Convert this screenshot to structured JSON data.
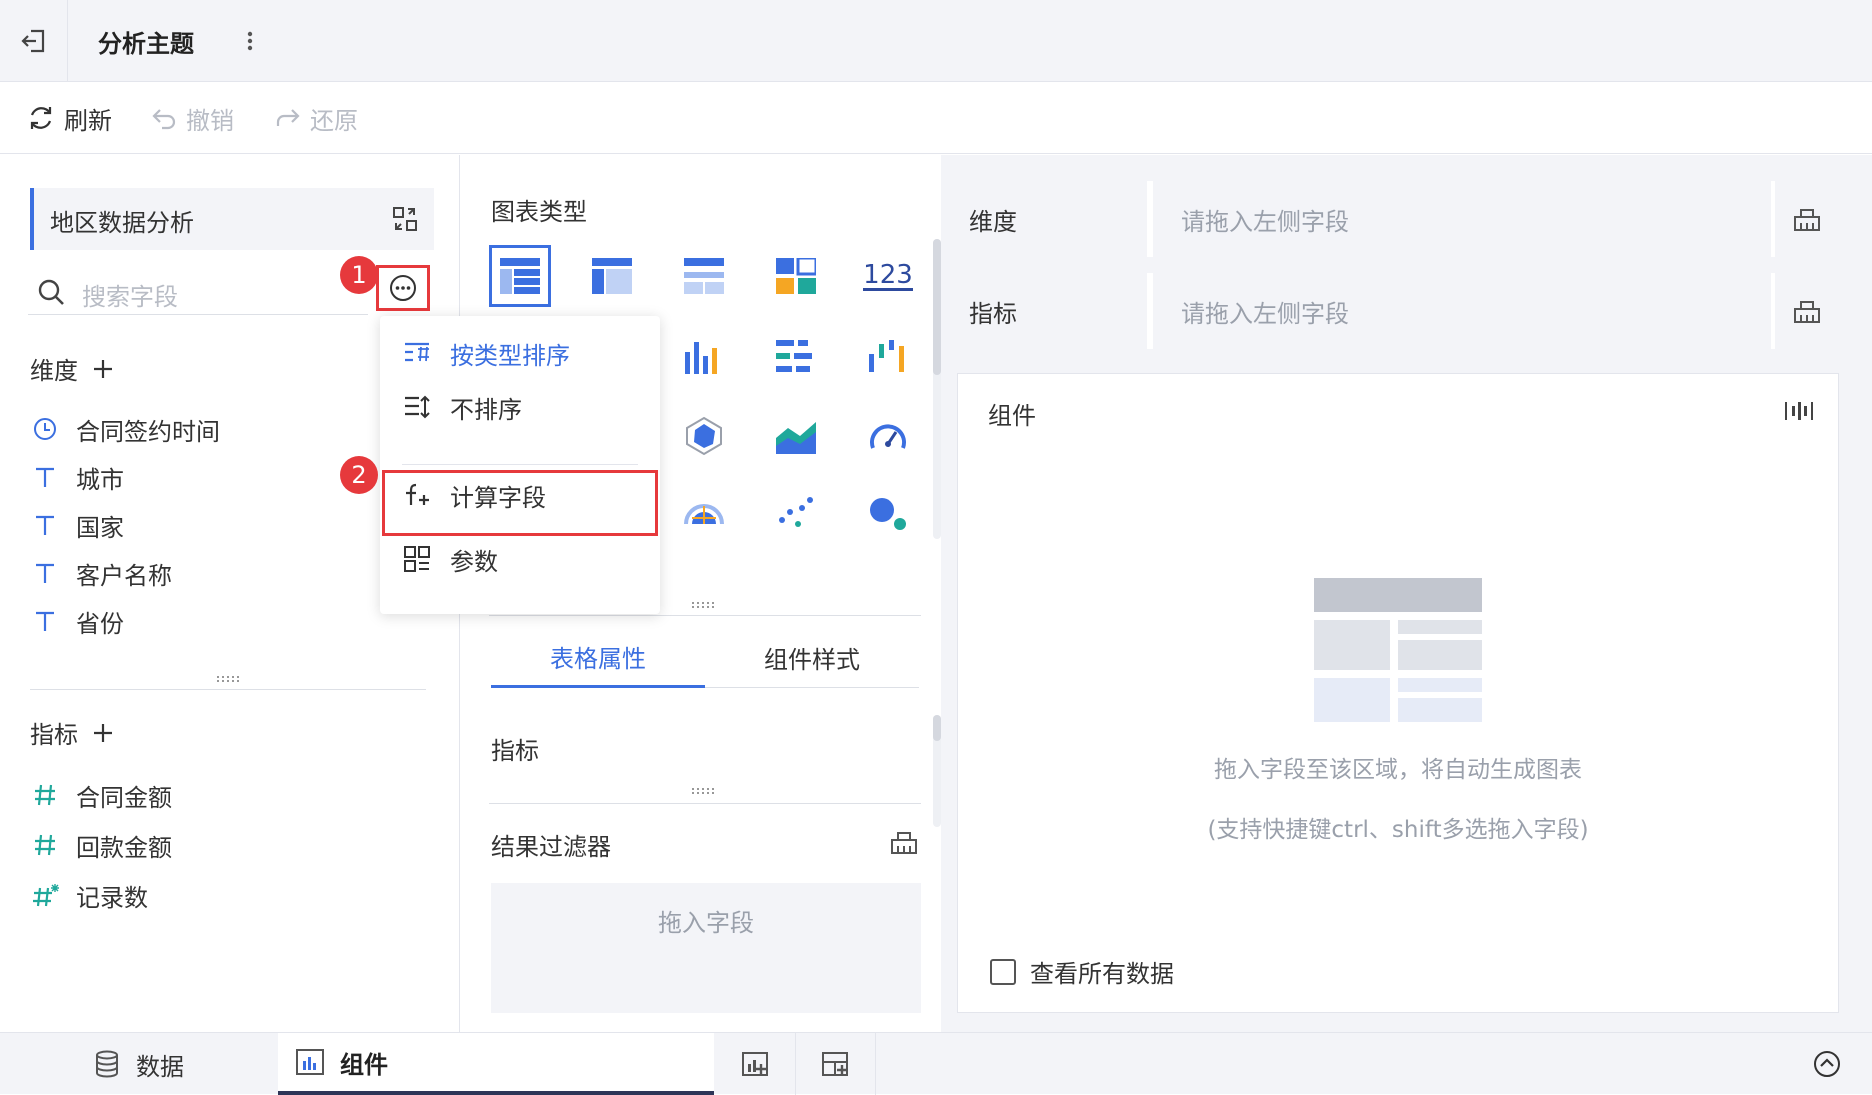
{
  "header": {
    "title": "分析主题"
  },
  "toolbar": {
    "refresh": "刷新",
    "undo": "撤销",
    "redo": "还原"
  },
  "left": {
    "dataset_name": "地区数据分析",
    "search_placeholder": "搜索字段",
    "dim_title": "维度",
    "dimensions": [
      {
        "icon": "clock-icon",
        "label": "合同签约时间"
      },
      {
        "icon": "text-type-icon",
        "label": "城市"
      },
      {
        "icon": "text-type-icon",
        "label": "国家"
      },
      {
        "icon": "text-type-icon",
        "label": "客户名称"
      },
      {
        "icon": "text-type-icon",
        "label": "省份"
      }
    ],
    "metric_title": "指标",
    "metrics": [
      {
        "icon": "number-type-icon",
        "label": "合同金额"
      },
      {
        "icon": "number-type-icon",
        "label": "回款金额"
      },
      {
        "icon": "count-type-icon",
        "label": "记录数"
      }
    ]
  },
  "menu": {
    "items": [
      "按类型排序",
      "不排序",
      "计算字段",
      "参数"
    ],
    "active_index": 0
  },
  "annotations": {
    "badge1": "1",
    "badge2": "2",
    "accent_red": "#e6393c"
  },
  "mid": {
    "chart_type_title": "图表类型",
    "kpi_icon_text": "123",
    "tabs": [
      "表格属性",
      "组件样式"
    ],
    "active_tab": 0,
    "metric_label": "指标",
    "filter_label": "结果过滤器",
    "filter_placeholder": "拖入字段"
  },
  "right": {
    "dim_label": "维度",
    "dim_placeholder": "请拖入左侧字段",
    "metric_label": "指标",
    "metric_placeholder": "请拖入左侧字段",
    "component_title": "组件",
    "empty_line1": "拖入字段至该区域，将自动生成图表",
    "empty_line2": "(支持快捷键ctrl、shift多选拖入字段)",
    "view_all": "查看所有数据"
  },
  "bottom": {
    "data_tab": "数据",
    "component_tab": "组件"
  },
  "colors": {
    "accent": "#3b6fe0",
    "teal": "#1fa89b",
    "red": "#e6393c"
  }
}
